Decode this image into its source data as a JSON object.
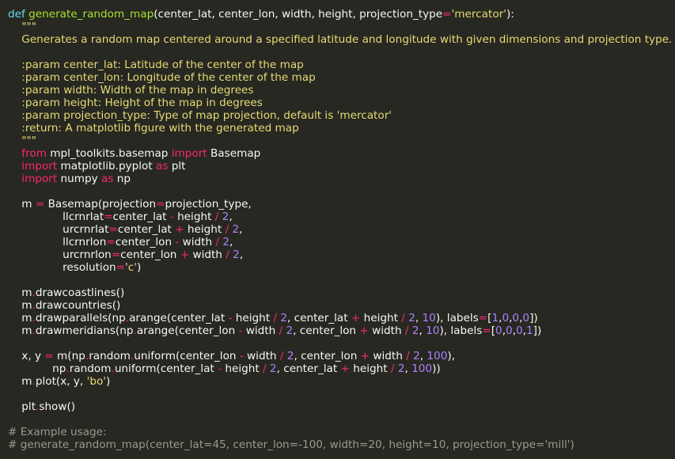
{
  "colors": {
    "background": "#272822",
    "text": "#f8f8f2",
    "keyword_def": "#66d9ef",
    "keyword_import": "#f92672",
    "function_name": "#a6e22e",
    "string": "#e6db74",
    "number": "#ae81ff",
    "operator": "#f92672",
    "comment": "#9a9a8e"
  },
  "code": [
    [
      [
        "kw",
        "def"
      ],
      [
        "txt",
        " "
      ],
      [
        "fn",
        "generate_random_map"
      ],
      [
        "txt",
        "(center_lat, center_lon, width, height, projection_type"
      ],
      [
        "op",
        "="
      ],
      [
        "str",
        "'mercator'"
      ],
      [
        "txt",
        "):"
      ]
    ],
    [
      [
        "doc",
        "    \"\"\""
      ]
    ],
    [
      [
        "doc",
        "    Generates a random map centered around a specified latitude and longitude with given dimensions and projection type."
      ]
    ],
    [
      [
        "txt",
        ""
      ]
    ],
    [
      [
        "doc",
        "    :param center_lat: Latitude of the center of the map"
      ]
    ],
    [
      [
        "doc",
        "    :param center_lon: Longitude of the center of the map"
      ]
    ],
    [
      [
        "doc",
        "    :param width: Width of the map in degrees"
      ]
    ],
    [
      [
        "doc",
        "    :param height: Height of the map in degrees"
      ]
    ],
    [
      [
        "doc",
        "    :param projection_type: Type of map projection, default is 'mercator'"
      ]
    ],
    [
      [
        "doc",
        "    :return: A matplotlib figure with the generated map"
      ]
    ],
    [
      [
        "doc",
        "    \"\"\""
      ]
    ],
    [
      [
        "txt",
        "    "
      ],
      [
        "kw2",
        "from"
      ],
      [
        "txt",
        " mpl_toolkits.basemap "
      ],
      [
        "kw2",
        "import"
      ],
      [
        "txt",
        " Basemap"
      ]
    ],
    [
      [
        "txt",
        "    "
      ],
      [
        "kw2",
        "import"
      ],
      [
        "txt",
        " matplotlib.pyplot "
      ],
      [
        "kw2",
        "as"
      ],
      [
        "txt",
        " plt"
      ]
    ],
    [
      [
        "txt",
        "    "
      ],
      [
        "kw2",
        "import"
      ],
      [
        "txt",
        " numpy "
      ],
      [
        "kw2",
        "as"
      ],
      [
        "txt",
        " np"
      ]
    ],
    [
      [
        "txt",
        ""
      ]
    ],
    [
      [
        "txt",
        "    m "
      ],
      [
        "op",
        "="
      ],
      [
        "txt",
        " Basemap(projection"
      ],
      [
        "op",
        "="
      ],
      [
        "txt",
        "projection_type,"
      ]
    ],
    [
      [
        "txt",
        "                llcrnrlat"
      ],
      [
        "op",
        "="
      ],
      [
        "txt",
        "center_lat "
      ],
      [
        "op",
        "-"
      ],
      [
        "txt",
        " height "
      ],
      [
        "op",
        "/"
      ],
      [
        "txt",
        " "
      ],
      [
        "num",
        "2"
      ],
      [
        "txt",
        ","
      ]
    ],
    [
      [
        "txt",
        "                urcrnrlat"
      ],
      [
        "op",
        "="
      ],
      [
        "txt",
        "center_lat "
      ],
      [
        "op",
        "+"
      ],
      [
        "txt",
        " height "
      ],
      [
        "op",
        "/"
      ],
      [
        "txt",
        " "
      ],
      [
        "num",
        "2"
      ],
      [
        "txt",
        ","
      ]
    ],
    [
      [
        "txt",
        "                llcrnrlon"
      ],
      [
        "op",
        "="
      ],
      [
        "txt",
        "center_lon "
      ],
      [
        "op",
        "-"
      ],
      [
        "txt",
        " width "
      ],
      [
        "op",
        "/"
      ],
      [
        "txt",
        " "
      ],
      [
        "num",
        "2"
      ],
      [
        "txt",
        ","
      ]
    ],
    [
      [
        "txt",
        "                urcrnrlon"
      ],
      [
        "op",
        "="
      ],
      [
        "txt",
        "center_lon "
      ],
      [
        "op",
        "+"
      ],
      [
        "txt",
        " width "
      ],
      [
        "op",
        "/"
      ],
      [
        "txt",
        " "
      ],
      [
        "num",
        "2"
      ],
      [
        "txt",
        ","
      ]
    ],
    [
      [
        "txt",
        "                resolution"
      ],
      [
        "op",
        "="
      ],
      [
        "str",
        "'c'"
      ],
      [
        "txt",
        ")"
      ]
    ],
    [
      [
        "txt",
        ""
      ]
    ],
    [
      [
        "txt",
        "    m"
      ],
      [
        "op",
        "."
      ],
      [
        "txt",
        "drawcoastlines()"
      ]
    ],
    [
      [
        "txt",
        "    m"
      ],
      [
        "op",
        "."
      ],
      [
        "txt",
        "drawcountries()"
      ]
    ],
    [
      [
        "txt",
        "    m"
      ],
      [
        "op",
        "."
      ],
      [
        "txt",
        "drawparallels(np"
      ],
      [
        "op",
        "."
      ],
      [
        "txt",
        "arange(center_lat "
      ],
      [
        "op",
        "-"
      ],
      [
        "txt",
        " height "
      ],
      [
        "op",
        "/"
      ],
      [
        "txt",
        " "
      ],
      [
        "num",
        "2"
      ],
      [
        "txt",
        ", center_lat "
      ],
      [
        "op",
        "+"
      ],
      [
        "txt",
        " height "
      ],
      [
        "op",
        "/"
      ],
      [
        "txt",
        " "
      ],
      [
        "num",
        "2"
      ],
      [
        "txt",
        ", "
      ],
      [
        "num",
        "10"
      ],
      [
        "txt",
        "), labels"
      ],
      [
        "op",
        "="
      ],
      [
        "txt",
        "["
      ],
      [
        "num",
        "1"
      ],
      [
        "txt",
        ","
      ],
      [
        "num",
        "0"
      ],
      [
        "txt",
        ","
      ],
      [
        "num",
        "0"
      ],
      [
        "txt",
        ","
      ],
      [
        "num",
        "0"
      ],
      [
        "txt",
        "])"
      ]
    ],
    [
      [
        "txt",
        "    m"
      ],
      [
        "op",
        "."
      ],
      [
        "txt",
        "drawmeridians(np"
      ],
      [
        "op",
        "."
      ],
      [
        "txt",
        "arange(center_lon "
      ],
      [
        "op",
        "-"
      ],
      [
        "txt",
        " width "
      ],
      [
        "op",
        "/"
      ],
      [
        "txt",
        " "
      ],
      [
        "num",
        "2"
      ],
      [
        "txt",
        ", center_lon "
      ],
      [
        "op",
        "+"
      ],
      [
        "txt",
        " width "
      ],
      [
        "op",
        "/"
      ],
      [
        "txt",
        " "
      ],
      [
        "num",
        "2"
      ],
      [
        "txt",
        ", "
      ],
      [
        "num",
        "10"
      ],
      [
        "txt",
        "), labels"
      ],
      [
        "op",
        "="
      ],
      [
        "txt",
        "["
      ],
      [
        "num",
        "0"
      ],
      [
        "txt",
        ","
      ],
      [
        "num",
        "0"
      ],
      [
        "txt",
        ","
      ],
      [
        "num",
        "0"
      ],
      [
        "txt",
        ","
      ],
      [
        "num",
        "1"
      ],
      [
        "txt",
        "])"
      ]
    ],
    [
      [
        "txt",
        ""
      ]
    ],
    [
      [
        "txt",
        "    x, y "
      ],
      [
        "op",
        "="
      ],
      [
        "txt",
        " m(np"
      ],
      [
        "op",
        "."
      ],
      [
        "txt",
        "random"
      ],
      [
        "op",
        "."
      ],
      [
        "txt",
        "uniform(center_lon "
      ],
      [
        "op",
        "-"
      ],
      [
        "txt",
        " width "
      ],
      [
        "op",
        "/"
      ],
      [
        "txt",
        " "
      ],
      [
        "num",
        "2"
      ],
      [
        "txt",
        ", center_lon "
      ],
      [
        "op",
        "+"
      ],
      [
        "txt",
        " width "
      ],
      [
        "op",
        "/"
      ],
      [
        "txt",
        " "
      ],
      [
        "num",
        "2"
      ],
      [
        "txt",
        ", "
      ],
      [
        "num",
        "100"
      ],
      [
        "txt",
        "),"
      ]
    ],
    [
      [
        "txt",
        "             np"
      ],
      [
        "op",
        "."
      ],
      [
        "txt",
        "random"
      ],
      [
        "op",
        "."
      ],
      [
        "txt",
        "uniform(center_lat "
      ],
      [
        "op",
        "-"
      ],
      [
        "txt",
        " height "
      ],
      [
        "op",
        "/"
      ],
      [
        "txt",
        " "
      ],
      [
        "num",
        "2"
      ],
      [
        "txt",
        ", center_lat "
      ],
      [
        "op",
        "+"
      ],
      [
        "txt",
        " height "
      ],
      [
        "op",
        "/"
      ],
      [
        "txt",
        " "
      ],
      [
        "num",
        "2"
      ],
      [
        "txt",
        ", "
      ],
      [
        "num",
        "100"
      ],
      [
        "txt",
        "))"
      ]
    ],
    [
      [
        "txt",
        "    m"
      ],
      [
        "op",
        "."
      ],
      [
        "txt",
        "plot(x, y, "
      ],
      [
        "str",
        "'bo'"
      ],
      [
        "txt",
        ")"
      ]
    ],
    [
      [
        "txt",
        ""
      ]
    ],
    [
      [
        "txt",
        "    plt"
      ],
      [
        "op",
        "."
      ],
      [
        "txt",
        "show()"
      ]
    ],
    [
      [
        "txt",
        ""
      ]
    ],
    [
      [
        "cmt",
        "# Example usage:"
      ]
    ],
    [
      [
        "cmt",
        "# generate_random_map(center_lat=45, center_lon=-100, width=20, height=10, projection_type='mill')"
      ]
    ]
  ]
}
